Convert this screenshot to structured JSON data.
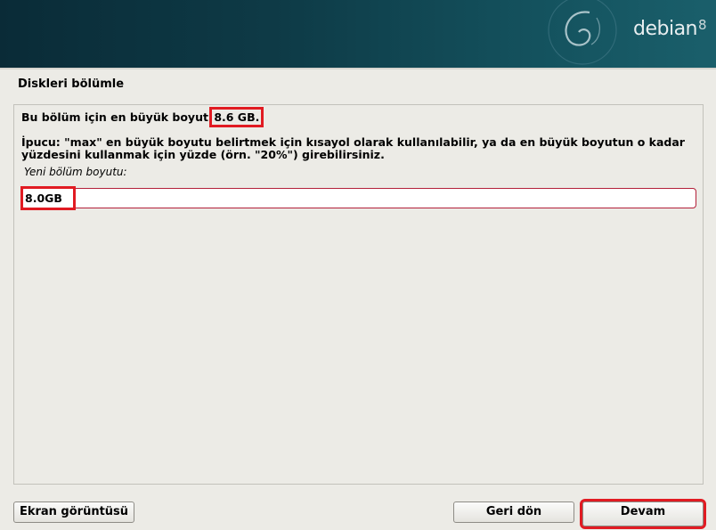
{
  "banner": {
    "brand": "debian",
    "version": "8"
  },
  "page": {
    "title": "Diskleri bölümle"
  },
  "content": {
    "max_prefix": "Bu bölüm için en büyük boyut",
    "max_value": "8.6 GB.",
    "hint": "İpucu: \"max\" en büyük boyutu belirtmek için kısayol olarak kullanılabilir, ya da en büyük boyutun o kadar yüzdesini kullanmak için yüzde (örn. \"20%\") girebilirsiniz.",
    "field_label": "Yeni bölüm boyutu:",
    "field_value": "8.0GB"
  },
  "buttons": {
    "screenshot": "Ekran görüntüsü",
    "back": "Geri dön",
    "continue": "Devam"
  },
  "colors": {
    "banner": "#0e3b47",
    "highlight": "#e11b22",
    "background": "#ecebe6"
  }
}
